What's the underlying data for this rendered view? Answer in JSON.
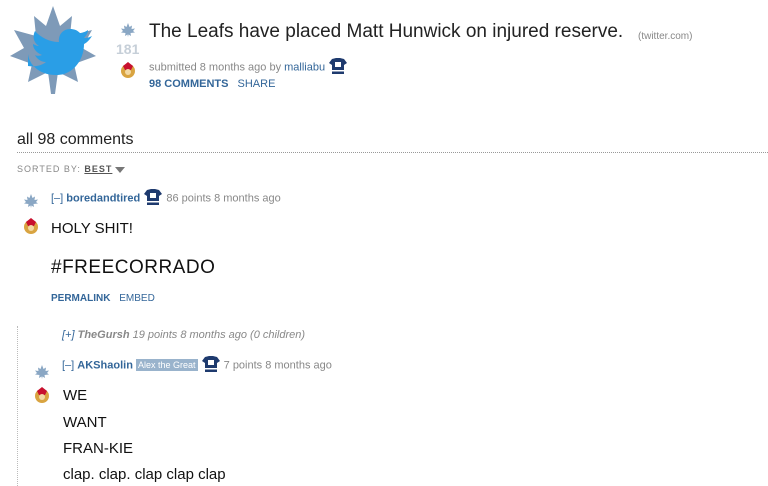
{
  "post": {
    "title": "The Leafs have placed Matt Hunwick on injured reserve.",
    "domain": "(twitter.com)",
    "score": "181",
    "submitted_prefix": "submitted 8 months ago by",
    "author": "malliabu",
    "comments_link": "98 COMMENTS",
    "share_link": "SHARE"
  },
  "comments_header": {
    "title": "all 98 comments",
    "sorted_label": "SORTED BY:",
    "sorted_value": "BEST"
  },
  "comments": [
    {
      "expand": "[–]",
      "author": "boredandtired",
      "meta": "86 points 8 months ago",
      "lines": [
        "HOLY SHIT!",
        "#FREECORRADO"
      ],
      "permalink": "PERMALINK",
      "embed": "EMBED"
    },
    {
      "expand": "[+]",
      "author": "TheGursh",
      "meta": "19 points 8 months ago (0 children)"
    },
    {
      "expand": "[–]",
      "author": "AKShaolin",
      "flair": "Alex the Great",
      "meta": "7 points 8 months ago",
      "lines": [
        "WE",
        "WANT",
        "FRAN-KIE",
        "clap. clap. clap clap clap"
      ]
    }
  ],
  "icons": {
    "thumbnail": "twitter-bird-maple-leaf-icon",
    "upvote": "maple-leaf-upvote-icon",
    "downvote": "senators-downvote-icon",
    "jersey": "leafs-jersey-icon"
  },
  "colors": {
    "link": "#336699",
    "twitter_blue": "#2a9ee6",
    "leaf_blue": "#8aa7c4",
    "flair_bg": "#99b3cc"
  }
}
